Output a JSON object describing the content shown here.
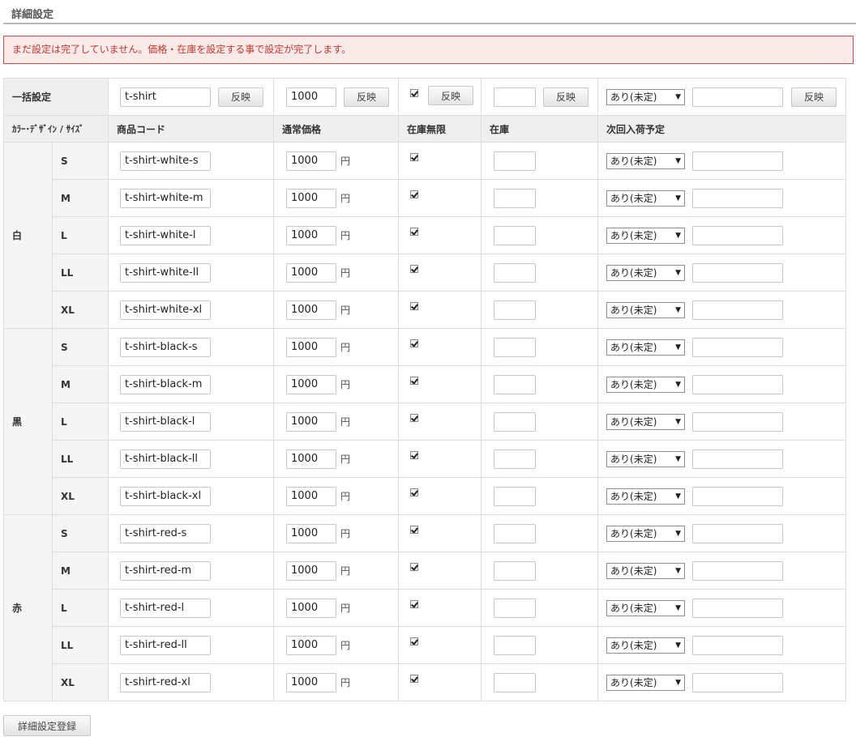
{
  "section_title": "詳細設定",
  "alert_text": "まだ設定は完了していません。価格・在庫を設定する事で設定が完了します。",
  "bulk": {
    "label": "一括設定",
    "code_value": "t-shirt",
    "price_value": "1000",
    "stock_value": "",
    "schedule_select": "あり(未定)",
    "schedule_text": "",
    "apply_label": "反映"
  },
  "headers": {
    "variant": "ｶﾗｰ･ﾃﾞｻﾞｲﾝ / ｻｲｽﾞ",
    "code": "商品コード",
    "price": "通常価格",
    "unlimited": "在庫無限",
    "stock": "在庫",
    "next_arrival": "次回入荷予定"
  },
  "yen_unit": "円",
  "select_value": "あり(未定)",
  "groups": [
    {
      "color": "白",
      "rows": [
        {
          "size": "S",
          "code": "t-shirt-white-s",
          "price": "1000",
          "unlimited": true
        },
        {
          "size": "M",
          "code": "t-shirt-white-m",
          "price": "1000",
          "unlimited": true
        },
        {
          "size": "L",
          "code": "t-shirt-white-l",
          "price": "1000",
          "unlimited": true
        },
        {
          "size": "LL",
          "code": "t-shirt-white-ll",
          "price": "1000",
          "unlimited": true
        },
        {
          "size": "XL",
          "code": "t-shirt-white-xl",
          "price": "1000",
          "unlimited": true
        }
      ]
    },
    {
      "color": "黒",
      "rows": [
        {
          "size": "S",
          "code": "t-shirt-black-s",
          "price": "1000",
          "unlimited": true
        },
        {
          "size": "M",
          "code": "t-shirt-black-m",
          "price": "1000",
          "unlimited": true
        },
        {
          "size": "L",
          "code": "t-shirt-black-l",
          "price": "1000",
          "unlimited": true
        },
        {
          "size": "LL",
          "code": "t-shirt-black-ll",
          "price": "1000",
          "unlimited": true
        },
        {
          "size": "XL",
          "code": "t-shirt-black-xl",
          "price": "1000",
          "unlimited": true
        }
      ]
    },
    {
      "color": "赤",
      "rows": [
        {
          "size": "S",
          "code": "t-shirt-red-s",
          "price": "1000",
          "unlimited": true
        },
        {
          "size": "M",
          "code": "t-shirt-red-m",
          "price": "1000",
          "unlimited": true
        },
        {
          "size": "L",
          "code": "t-shirt-red-l",
          "price": "1000",
          "unlimited": true
        },
        {
          "size": "LL",
          "code": "t-shirt-red-ll",
          "price": "1000",
          "unlimited": true
        },
        {
          "size": "XL",
          "code": "t-shirt-red-xl",
          "price": "1000",
          "unlimited": true
        }
      ]
    }
  ],
  "register_button": "詳細設定登録",
  "colors": {
    "alert_border": "#d64848",
    "alert_bg": "#fbeaea",
    "alert_text": "#c0392b",
    "header_bg": "#efefef"
  }
}
